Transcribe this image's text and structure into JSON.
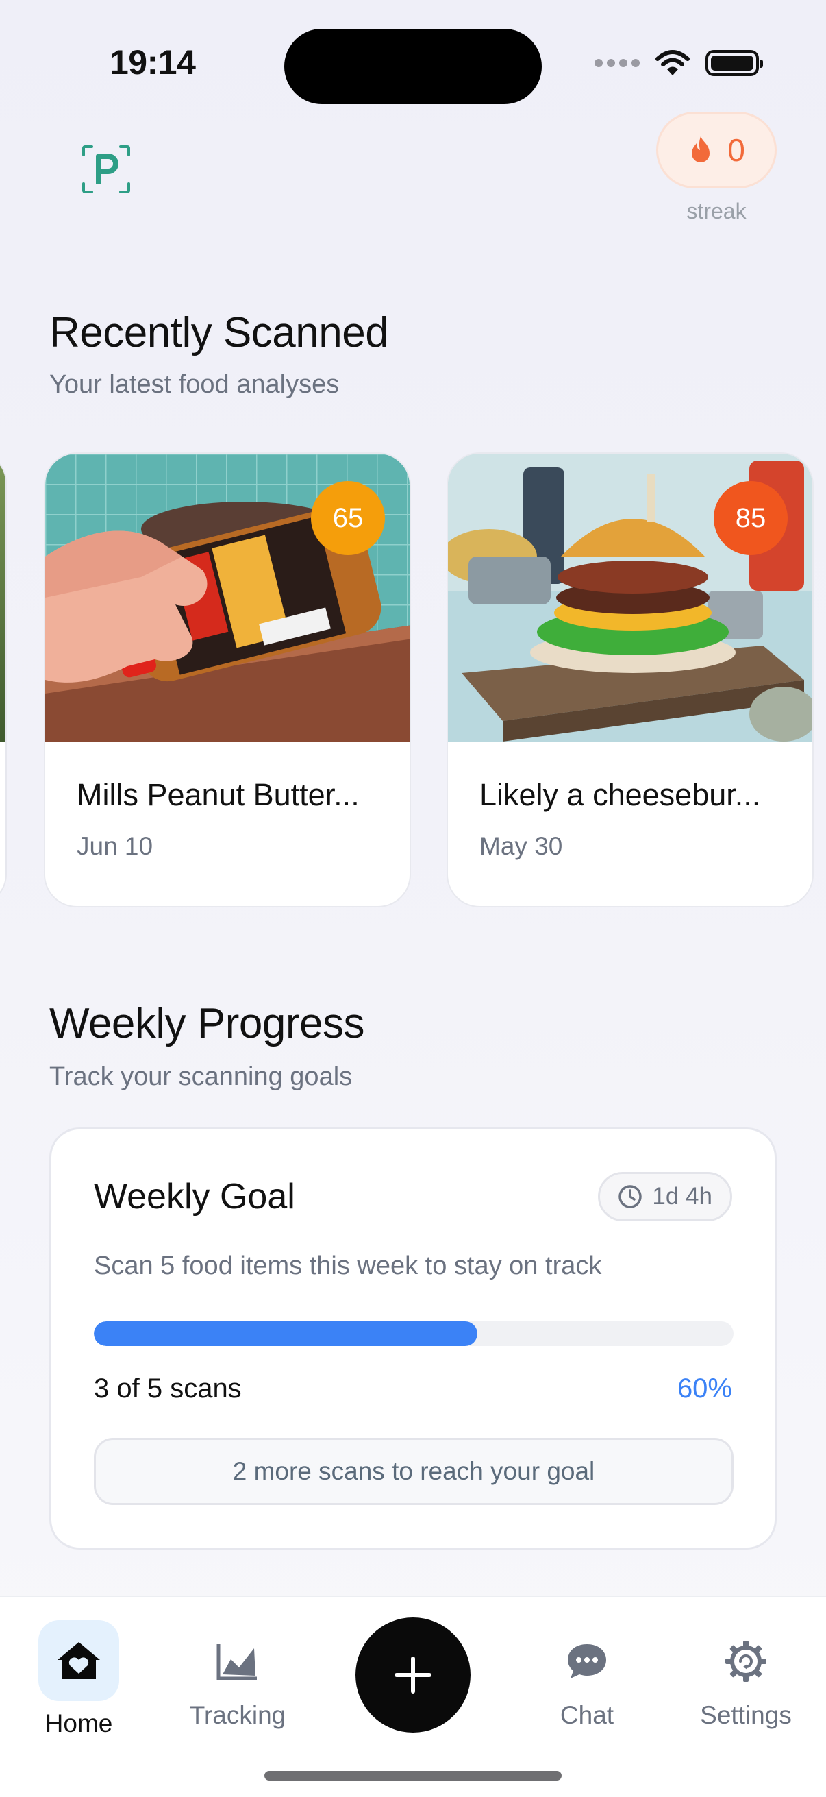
{
  "status_bar": {
    "time": "19:14"
  },
  "header": {
    "streak": {
      "count": "0",
      "label": "streak"
    }
  },
  "recent": {
    "title": "Recently Scanned",
    "subtitle": "Your latest food analyses",
    "cards": [
      {
        "name": "Mills Peanut Butter...",
        "date": "Jun 10",
        "score": "65",
        "score_color": "#f59e0b"
      },
      {
        "name": "Likely a cheesebur...",
        "date": "May 30",
        "score": "85",
        "score_color": "#f0561e"
      }
    ]
  },
  "weekly": {
    "title": "Weekly Progress",
    "subtitle": "Track your scanning goals",
    "goal": {
      "title": "Weekly Goal",
      "time_left": "1d 4h",
      "description": "Scan 5 food items this week to stay on track",
      "progress_fraction": 0.6,
      "count_text": "3 of 5 scans",
      "percent_text": "60%",
      "remaining_text": "2 more scans to reach your goal"
    }
  },
  "nav": {
    "home": "Home",
    "tracking": "Tracking",
    "chat": "Chat",
    "settings": "Settings"
  },
  "colors": {
    "accent_blue": "#3b82f6",
    "streak_orange": "#f26a3a",
    "logo_teal": "#2e9e86"
  }
}
